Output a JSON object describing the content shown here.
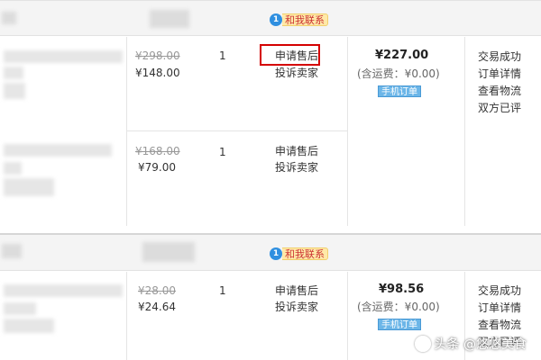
{
  "contact_label": "和我联系",
  "contact_icon": "contact-bubble-icon",
  "orders": [
    {
      "items": [
        {
          "orig_price": "¥298.00",
          "price": "¥148.00",
          "qty": "1",
          "action1": "申请售后",
          "action2": "投诉卖家"
        },
        {
          "orig_price": "¥168.00",
          "price": "¥79.00",
          "qty": "1",
          "action1": "申请售后",
          "action2": "投诉卖家"
        }
      ],
      "total": "¥227.00",
      "shipping": "(含运费：¥0.00)",
      "badge": "手机订单",
      "status": [
        "交易成功",
        "订单详情",
        "查看物流",
        "双方已评"
      ]
    },
    {
      "items": [
        {
          "orig_price": "¥28.00",
          "price": "¥24.64",
          "qty": "1",
          "action1": "申请售后",
          "action2": "投诉卖家"
        }
      ],
      "total": "¥98.56",
      "shipping": "(含运费：¥0.00)",
      "badge": "手机订单",
      "status": [
        "交易成功",
        "订单详情",
        "查看物流",
        "双方已评"
      ]
    }
  ],
  "watermark": "头条 @悠悠美食",
  "colors": {
    "highlight_box": "#d40000",
    "badge_bg": "#6cb6e8",
    "contact_bg": "#ffe9a8"
  }
}
